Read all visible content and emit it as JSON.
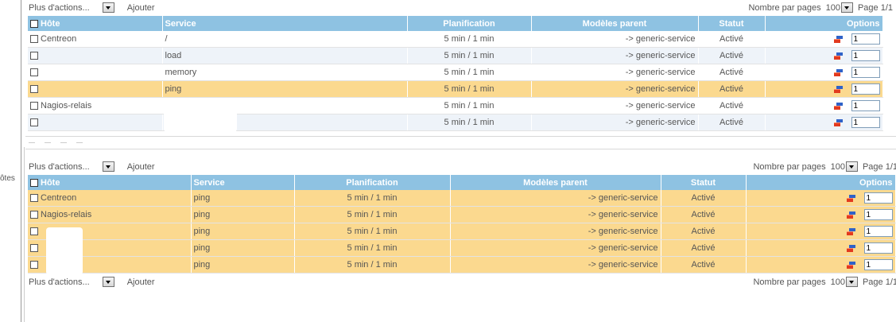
{
  "side_label": "ôtes",
  "table1": {
    "toolbar": {
      "more_actions": "Plus d'actions...",
      "add": "Ajouter",
      "per_page_label": "Nombre par pages",
      "per_page_value": "100",
      "page": "Page 1/1"
    },
    "headers": {
      "host": "Hôte",
      "service": "Service",
      "schedule": "Planification",
      "parent": "Modèles parent",
      "status": "Statut",
      "options": "Options"
    },
    "rows": [
      {
        "host": "Centreon",
        "service": "/",
        "schedule": "5 min / 1 min",
        "parent": "-> generic-service",
        "status": "Activé",
        "qty": "1"
      },
      {
        "host": "",
        "service": "load",
        "schedule": "5 min / 1 min",
        "parent": "-> generic-service",
        "status": "Activé",
        "qty": "1"
      },
      {
        "host": "",
        "service": "memory",
        "schedule": "5 min / 1 min",
        "parent": "-> generic-service",
        "status": "Activé",
        "qty": "1"
      },
      {
        "host": "",
        "service": "ping",
        "schedule": "5 min / 1 min",
        "parent": "-> generic-service",
        "status": "Activé",
        "qty": "1"
      },
      {
        "host": "Nagios-relais",
        "service": "",
        "schedule": "5 min / 1 min",
        "parent": "-> generic-service",
        "status": "Activé",
        "qty": "1"
      },
      {
        "host": "",
        "service": "",
        "schedule": "5 min / 1 min",
        "parent": "-> generic-service",
        "status": "Activé",
        "qty": "1"
      }
    ]
  },
  "table2": {
    "toolbar": {
      "more_actions": "Plus d'actions...",
      "add": "Ajouter",
      "per_page_label": "Nombre par pages",
      "per_page_value": "100",
      "page": "Page 1/1"
    },
    "headers": {
      "host": "Hôte",
      "service": "Service",
      "schedule": "Planification",
      "parent": "Modèles parent",
      "status": "Statut",
      "options": "Options"
    },
    "rows": [
      {
        "host": "Centreon",
        "service": "ping",
        "schedule": "5 min / 1 min",
        "parent": "-> generic-service",
        "status": "Activé",
        "qty": "1"
      },
      {
        "host": "Nagios-relais",
        "service": "ping",
        "schedule": "5 min / 1 min",
        "parent": "-> generic-service",
        "status": "Activé",
        "qty": "1"
      },
      {
        "host": "",
        "service": "ping",
        "schedule": "5 min / 1 min",
        "parent": "-> generic-service",
        "status": "Activé",
        "qty": "1"
      },
      {
        "host": "",
        "service": "ping",
        "schedule": "5 min / 1 min",
        "parent": "-> generic-service",
        "status": "Activé",
        "qty": "1"
      },
      {
        "host": "",
        "service": "ping",
        "schedule": "5 min / 1 min",
        "parent": "-> generic-service",
        "status": "Activé",
        "qty": "1"
      }
    ],
    "bottom_toolbar": {
      "more_actions": "Plus d'actions...",
      "add": "Ajouter",
      "per_page_label": "Nombre par pages",
      "per_page_value": "100",
      "page": "Page 1/1"
    }
  },
  "colors": {
    "header": "#8ec2e2",
    "highlight": "#fbd98f",
    "row_alt": "#eef3f9"
  },
  "icons": {
    "duplicate": "duplicate-icon",
    "dropdown": "chevron-down-icon"
  }
}
